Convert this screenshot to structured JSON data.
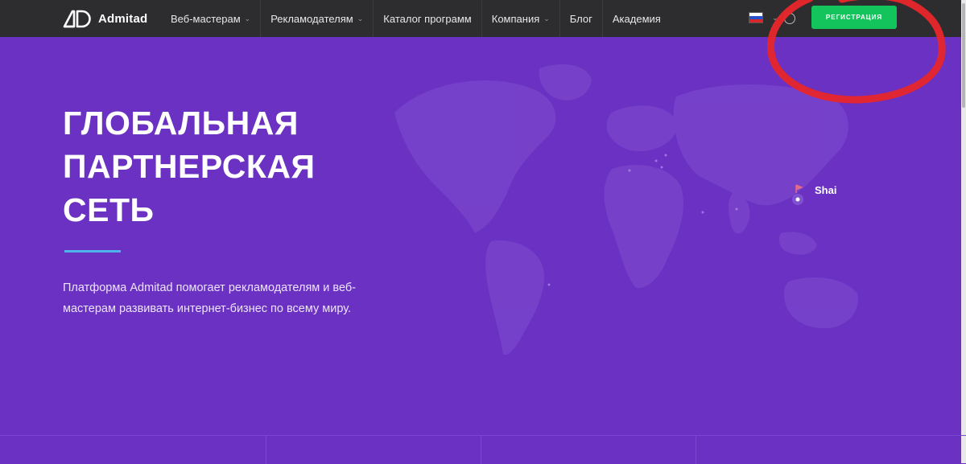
{
  "colors": {
    "background_purple": "#6a31c2",
    "topbar": "#2d2d2f",
    "register_green": "#13c45d",
    "accent_line": "#4fb3e8",
    "annotation_red": "#e8262b"
  },
  "header": {
    "logo_text": "Admitad",
    "nav": [
      {
        "label": "Веб-мастерам",
        "has_dropdown": true
      },
      {
        "label": "Рекламодателям",
        "has_dropdown": true
      },
      {
        "label": "Каталог программ",
        "has_dropdown": false
      },
      {
        "label": "Компания",
        "has_dropdown": true
      },
      {
        "label": "Блог",
        "has_dropdown": false
      },
      {
        "label": "Академия",
        "has_dropdown": false
      }
    ],
    "language_icon": "russia-flag-icon",
    "register_label": "РЕГИСТРАЦИЯ"
  },
  "hero": {
    "title_lines": [
      "ГЛОБАЛЬНАЯ",
      "ПАРТНЕРСКАЯ",
      "СЕТЬ"
    ],
    "description": "Платформа Admitad помогает рекламодателям и веб-мастерам развивать интернет-бизнес по всему миру.",
    "map_city_label": "Shai"
  },
  "annotation": {
    "shape": "red-freehand-circle",
    "target": "register-button"
  }
}
